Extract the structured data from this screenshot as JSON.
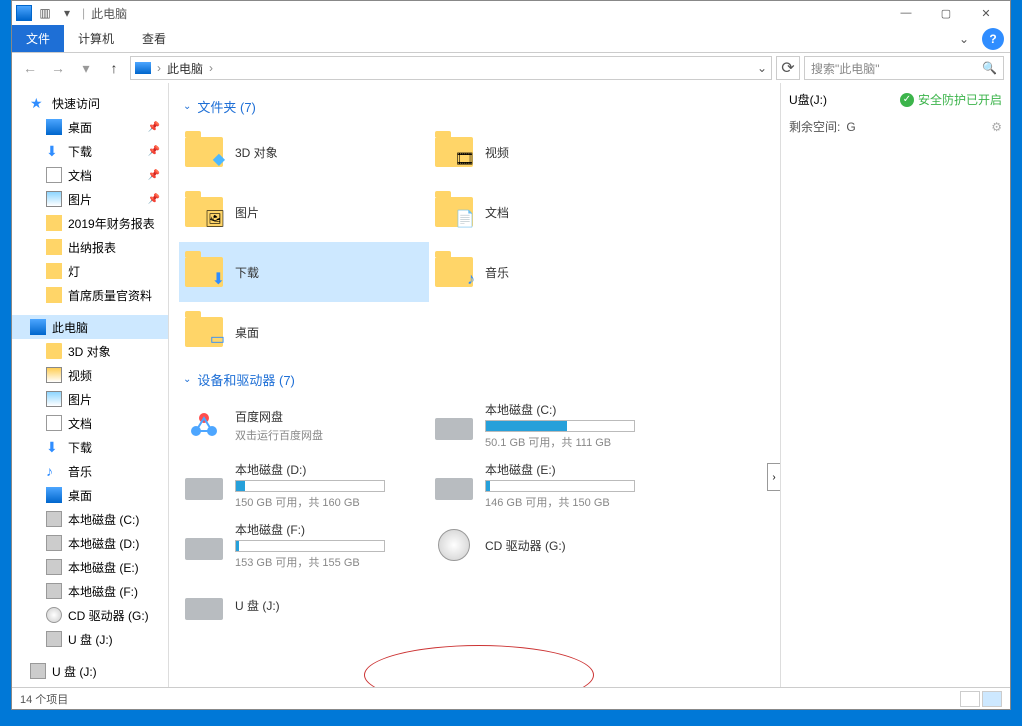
{
  "titlebar": {
    "title": "此电脑"
  },
  "ribbon": {
    "file": "文件",
    "computer": "计算机",
    "view": "查看"
  },
  "nav": {
    "location": "此电脑",
    "search_placeholder": "搜索\"此电脑\""
  },
  "tree": {
    "quick": "快速访问",
    "desktop": "桌面",
    "downloads": "下载",
    "documents": "文档",
    "pictures": "图片",
    "f1": "2019年财务报表",
    "f2": "出纳报表",
    "f3": "灯",
    "f4": "首席质量官资料",
    "thispc": "此电脑",
    "obj3d": "3D 对象",
    "video": "视频",
    "pictures2": "图片",
    "documents2": "文档",
    "downloads2": "下载",
    "music": "音乐",
    "desktop2": "桌面",
    "driveC": "本地磁盘 (C:)",
    "driveD": "本地磁盘 (D:)",
    "driveE": "本地磁盘 (E:)",
    "driveF": "本地磁盘 (F:)",
    "cdG": "CD 驱动器 (G:)",
    "usbJ": "U 盘 (J:)",
    "usbJ2": "U 盘 (J:)"
  },
  "sections": {
    "folders": "文件夹 (7)",
    "devices": "设备和驱动器 (7)"
  },
  "folders": {
    "obj3d": "3D 对象",
    "video": "视频",
    "pictures": "图片",
    "documents": "文档",
    "downloads": "下载",
    "music": "音乐",
    "desktop": "桌面"
  },
  "drives": {
    "baidu": {
      "name": "百度网盘",
      "sub": "双击运行百度网盘"
    },
    "c": {
      "name": "本地磁盘 (C:)",
      "space": "50.1 GB 可用，共 111 GB",
      "used": 55
    },
    "d": {
      "name": "本地磁盘 (D:)",
      "space": "150 GB 可用，共 160 GB",
      "used": 6
    },
    "e": {
      "name": "本地磁盘 (E:)",
      "space": "146 GB 可用，共 150 GB",
      "used": 3
    },
    "f": {
      "name": "本地磁盘 (F:)",
      "space": "153 GB 可用，共 155 GB",
      "used": 2
    },
    "cd": {
      "name": "CD 驱动器 (G:)"
    },
    "usb": {
      "name": "U 盘 (J:)"
    }
  },
  "preview": {
    "title": "U盘(J:)",
    "shield": "安全防护已开启",
    "space_label": "剩余空间:",
    "space_value": "G"
  },
  "status": {
    "items": "14 个项目"
  }
}
